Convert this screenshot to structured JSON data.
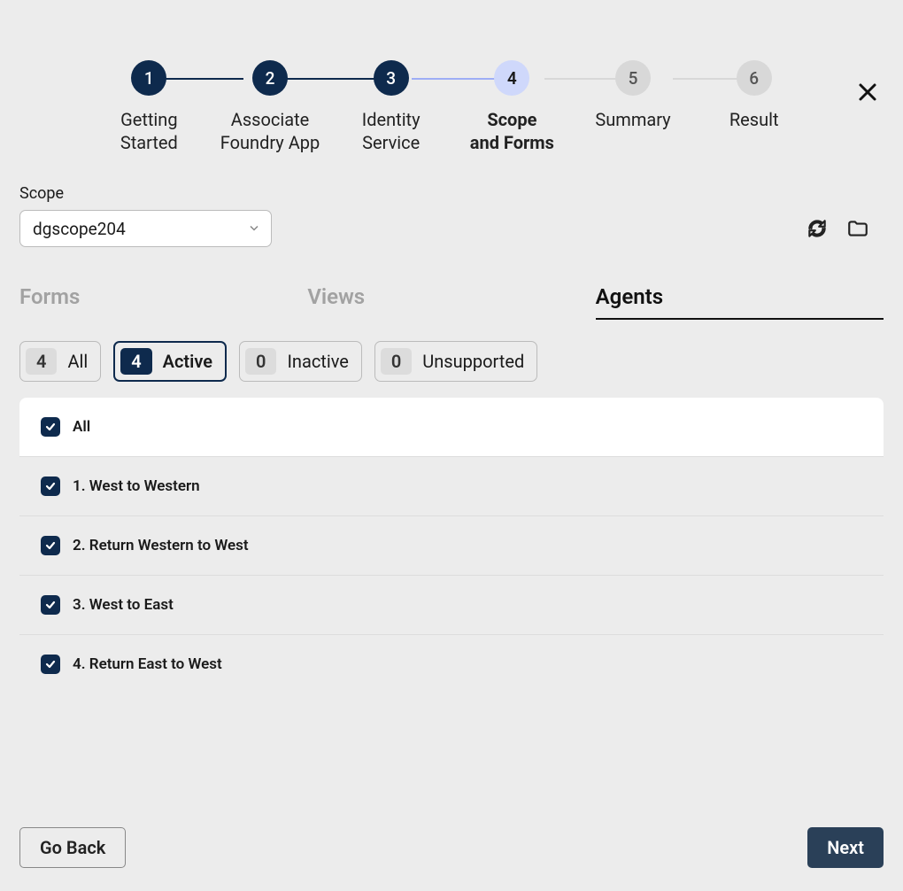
{
  "stepper": {
    "steps": [
      {
        "num": "1",
        "label": "Getting\nStarted",
        "state": "done"
      },
      {
        "num": "2",
        "label": "Associate\nFoundry App",
        "state": "done"
      },
      {
        "num": "3",
        "label": "Identity\nService",
        "state": "done"
      },
      {
        "num": "4",
        "label": "Scope\nand Forms",
        "state": "current"
      },
      {
        "num": "5",
        "label": "Summary",
        "state": "future"
      },
      {
        "num": "6",
        "label": "Result",
        "state": "future"
      }
    ]
  },
  "scope": {
    "label": "Scope",
    "value": "dgscope204"
  },
  "tabs": {
    "forms": "Forms",
    "views": "Views",
    "agents": "Agents",
    "active": "agents"
  },
  "filters": {
    "all": {
      "count": "4",
      "label": "All"
    },
    "active": {
      "count": "4",
      "label": "Active"
    },
    "inactive": {
      "count": "0",
      "label": "Inactive"
    },
    "unsupported": {
      "count": "0",
      "label": "Unsupported"
    },
    "selected": "active"
  },
  "list": {
    "all_label": "All",
    "items": [
      "1. West to Western",
      "2. Return Western to West",
      "3. West to East",
      "4. Return East to West"
    ]
  },
  "footer": {
    "back": "Go Back",
    "next": "Next"
  }
}
